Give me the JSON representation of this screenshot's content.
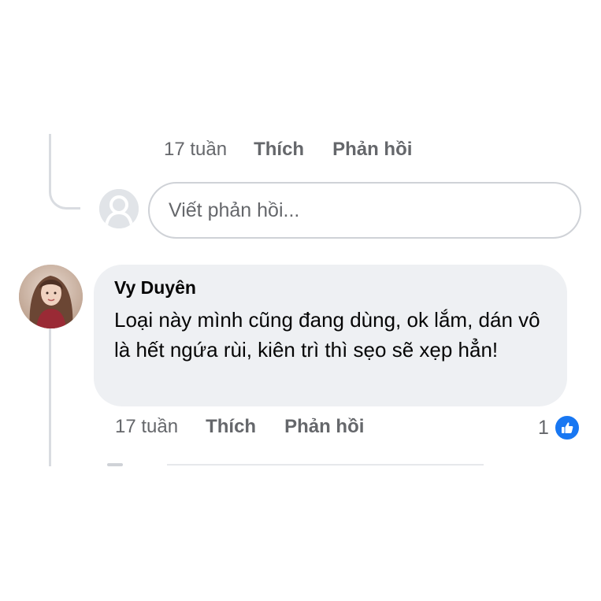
{
  "previous_comment": {
    "time": "17 tuần",
    "like_label": "Thích",
    "reply_label": "Phản hồi"
  },
  "reply_box": {
    "placeholder": "Viết phản hồi..."
  },
  "comment": {
    "author": "Vy Duyên",
    "text": "Loại này mình cũng đang dùng, ok lắm, dán vô là hết ngứa rùi, kiên trì thì sẹo sẽ xẹp hẳn!",
    "time": "17 tuần",
    "like_label": "Thích",
    "reply_label": "Phản hồi",
    "reaction_count": "1",
    "reaction_icon": "thumbs-up-icon"
  },
  "colors": {
    "accent": "#1877f2",
    "bubble": "#eef0f3",
    "meta_text": "#65676b"
  }
}
